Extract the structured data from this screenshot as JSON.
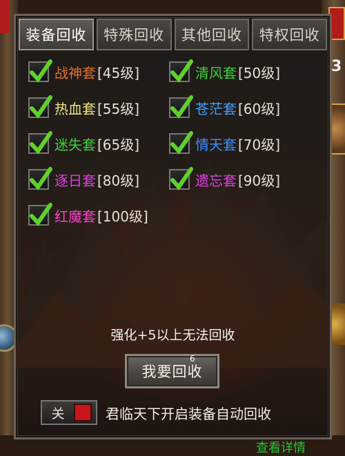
{
  "tabs": [
    {
      "label": "装备回收",
      "active": true
    },
    {
      "label": "特殊回收",
      "active": false
    },
    {
      "label": "其他回收",
      "active": false
    },
    {
      "label": "特权回收",
      "active": false
    }
  ],
  "sets": [
    {
      "name": "战神套",
      "level": "[45级]",
      "color": "#e0702a",
      "checked": true
    },
    {
      "name": "清风套",
      "level": "[50级]",
      "color": "#3cd23c",
      "checked": true
    },
    {
      "name": "热血套",
      "level": "[55级]",
      "color": "#f0e67a",
      "checked": true
    },
    {
      "name": "苍茫套",
      "level": "[60级]",
      "color": "#3fa0ff",
      "checked": true
    },
    {
      "name": "迷失套",
      "level": "[65级]",
      "color": "#3cd23c",
      "checked": true
    },
    {
      "name": "情天套",
      "level": "[70级]",
      "color": "#3f8cff",
      "checked": true
    },
    {
      "name": "逐日套",
      "level": "[80级]",
      "color": "#e040e0",
      "checked": true
    },
    {
      "name": "遗忘套",
      "level": "[90级]",
      "color": "#e040e0",
      "checked": true
    },
    {
      "name": "红魔套",
      "level": "[100级]",
      "color": "#ff40d0",
      "checked": true
    }
  ],
  "notice": "强化+5以上无法回收",
  "badge": "6",
  "recycle_button": "我要回收",
  "auto_toggle": {
    "label": "关",
    "state": "off"
  },
  "auto_text": "君临天下开启装备自动回收",
  "footer_link": "查看详情",
  "right_edge_number": "3"
}
